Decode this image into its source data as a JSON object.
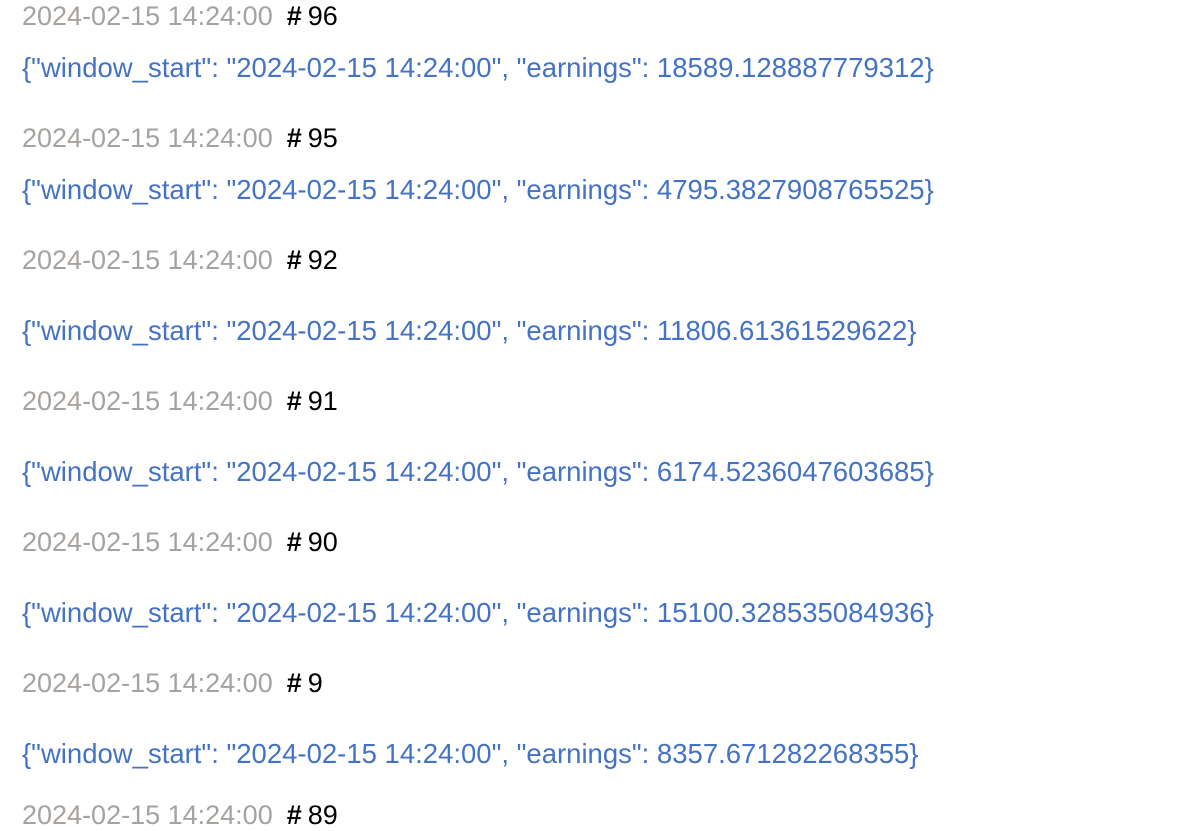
{
  "entries": [
    {
      "timestamp": "2024-02-15 14:24:00",
      "id": "96",
      "payload": "{\"window_start\": \"2024-02-15 14:24:00\", \"earnings\": 18589.128887779312}"
    },
    {
      "timestamp": "2024-02-15 14:24:00",
      "id": "95",
      "payload": "{\"window_start\": \"2024-02-15 14:24:00\", \"earnings\": 4795.3827908765525}"
    },
    {
      "timestamp": "2024-02-15 14:24:00",
      "id": "92",
      "payload": "{\"window_start\": \"2024-02-15 14:24:00\", \"earnings\": 11806.61361529622}"
    },
    {
      "timestamp": "2024-02-15 14:24:00",
      "id": "91",
      "payload": "{\"window_start\": \"2024-02-15 14:24:00\", \"earnings\": 6174.5236047603685}"
    },
    {
      "timestamp": "2024-02-15 14:24:00",
      "id": "90",
      "payload": "{\"window_start\": \"2024-02-15 14:24:00\", \"earnings\": 15100.328535084936}"
    },
    {
      "timestamp": "2024-02-15 14:24:00",
      "id": "9",
      "payload": "{\"window_start\": \"2024-02-15 14:24:00\", \"earnings\": 8357.671282268355}"
    },
    {
      "timestamp": "2024-02-15 14:24:00",
      "id": "89"
    }
  ],
  "hash_symbol": "#",
  "colors": {
    "timestamp": "#a6a29f",
    "payload": "#4472c4",
    "id": "#000000"
  }
}
